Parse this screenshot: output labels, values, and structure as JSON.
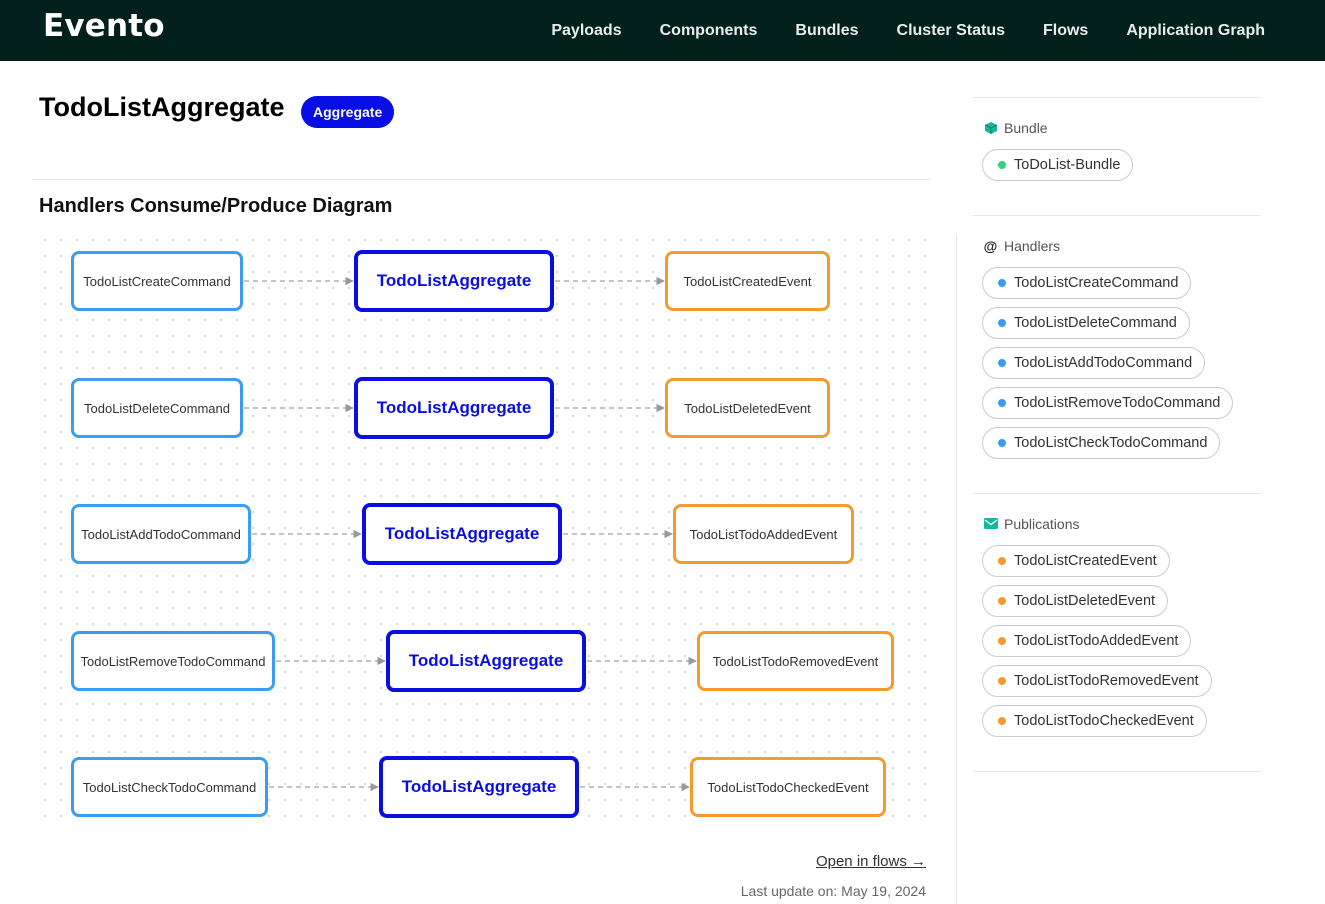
{
  "header": {
    "logo": "Evento",
    "nav": [
      "Payloads",
      "Components",
      "Bundles",
      "Cluster Status",
      "Flows",
      "Application Graph"
    ]
  },
  "page": {
    "title": "TodoListAggregate",
    "type_badge": "Aggregate",
    "section_title": "Handlers Consume/Produce Diagram",
    "open_flows": "Open in flows →",
    "last_update": "Last update on: May 19, 2024"
  },
  "diagram": {
    "rows": [
      {
        "command": "TodoListCreateCommand",
        "aggregate": "TodoListAggregate",
        "event": "TodoListCreatedEvent"
      },
      {
        "command": "TodoListDeleteCommand",
        "aggregate": "TodoListAggregate",
        "event": "TodoListDeletedEvent"
      },
      {
        "command": "TodoListAddTodoCommand",
        "aggregate": "TodoListAggregate",
        "event": "TodoListTodoAddedEvent"
      },
      {
        "command": "TodoListRemoveTodoCommand",
        "aggregate": "TodoListAggregate",
        "event": "TodoListTodoRemovedEvent"
      },
      {
        "command": "TodoListCheckTodoCommand",
        "aggregate": "TodoListAggregate",
        "event": "TodoListTodoCheckedEvent"
      }
    ]
  },
  "sidebar": {
    "bundle": {
      "heading": "Bundle",
      "icon": "cube-icon",
      "items": [
        "ToDoList-Bundle"
      ]
    },
    "handlers": {
      "heading": "Handlers",
      "icon": "at-icon",
      "items": [
        "TodoListCreateCommand",
        "TodoListDeleteCommand",
        "TodoListAddTodoCommand",
        "TodoListRemoveTodoCommand",
        "TodoListCheckTodoCommand"
      ]
    },
    "publications": {
      "heading": "Publications",
      "icon": "envelope-icon",
      "items": [
        "TodoListCreatedEvent",
        "TodoListDeletedEvent",
        "TodoListTodoAddedEvent",
        "TodoListTodoRemovedEvent",
        "TodoListTodoCheckedEvent"
      ]
    }
  },
  "colors": {
    "topbar": "#04201c",
    "aggregate": "#0a0ee6",
    "command": "#3b9cf0",
    "event": "#f59a2c",
    "bundle_dot": "#34d17a",
    "icon_teal": "#14b89a"
  }
}
